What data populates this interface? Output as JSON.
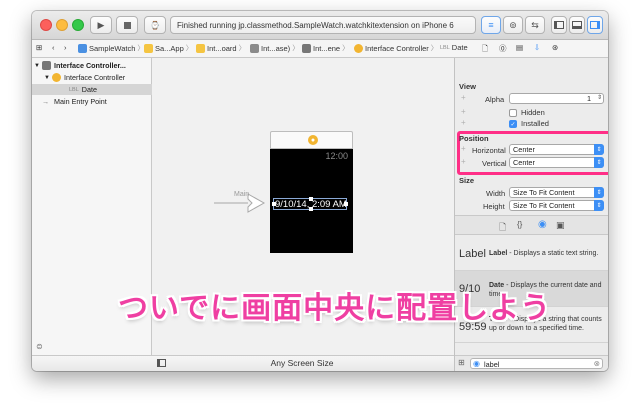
{
  "toolbar": {
    "status": "Finished running jp.classmethod.SampleWatch.watchkitextension on iPhone 6"
  },
  "jump_bar": {
    "items": [
      "SampleWatch",
      "Sa...App",
      "Int...oard",
      "Int...ase)",
      "Int...ene",
      "Interface Controller",
      "Date"
    ]
  },
  "navigator": {
    "scene_title": "Interface Controller...",
    "controller": "Interface Controller",
    "date_badge": "LBL",
    "date_item": "Date",
    "entry_point": "Main Entry Point"
  },
  "canvas": {
    "main_arrow_label": "Main",
    "status_time": "12:00",
    "date_label": "9/10/14, 2:09 AM",
    "bottom_size": "Any Screen Size"
  },
  "inspector": {
    "view_section": "View",
    "alpha_label": "Alpha",
    "alpha_value": "1",
    "hidden_label": "Hidden",
    "hidden_checked": false,
    "installed_label": "Installed",
    "installed_checked": true,
    "position_section": "Position",
    "horizontal_label": "Horizontal",
    "horizontal_value": "Center",
    "vertical_label": "Vertical",
    "vertical_value": "Center",
    "size_section": "Size",
    "width_label": "Width",
    "width_value": "Size To Fit Content",
    "height_label": "Height",
    "height_value": "Size To Fit Content"
  },
  "library": {
    "items": [
      {
        "preview": "Label",
        "title": "Label",
        "desc": " - Displays a static text string."
      },
      {
        "preview": "9/10",
        "title": "Date",
        "desc": " - Displays the current date and time."
      },
      {
        "preview": "59:59",
        "title": "Timer",
        "desc": " - Displays a string that counts up or down to a specified time."
      }
    ],
    "search_value": "label"
  },
  "overlay_caption": "ついでに画面中央に配置しよう",
  "colors": {
    "accent": "#3d8ff5",
    "highlight_box": "#ff2f87",
    "caption": "#ef3fa2",
    "date_icon": "#f2b531"
  }
}
